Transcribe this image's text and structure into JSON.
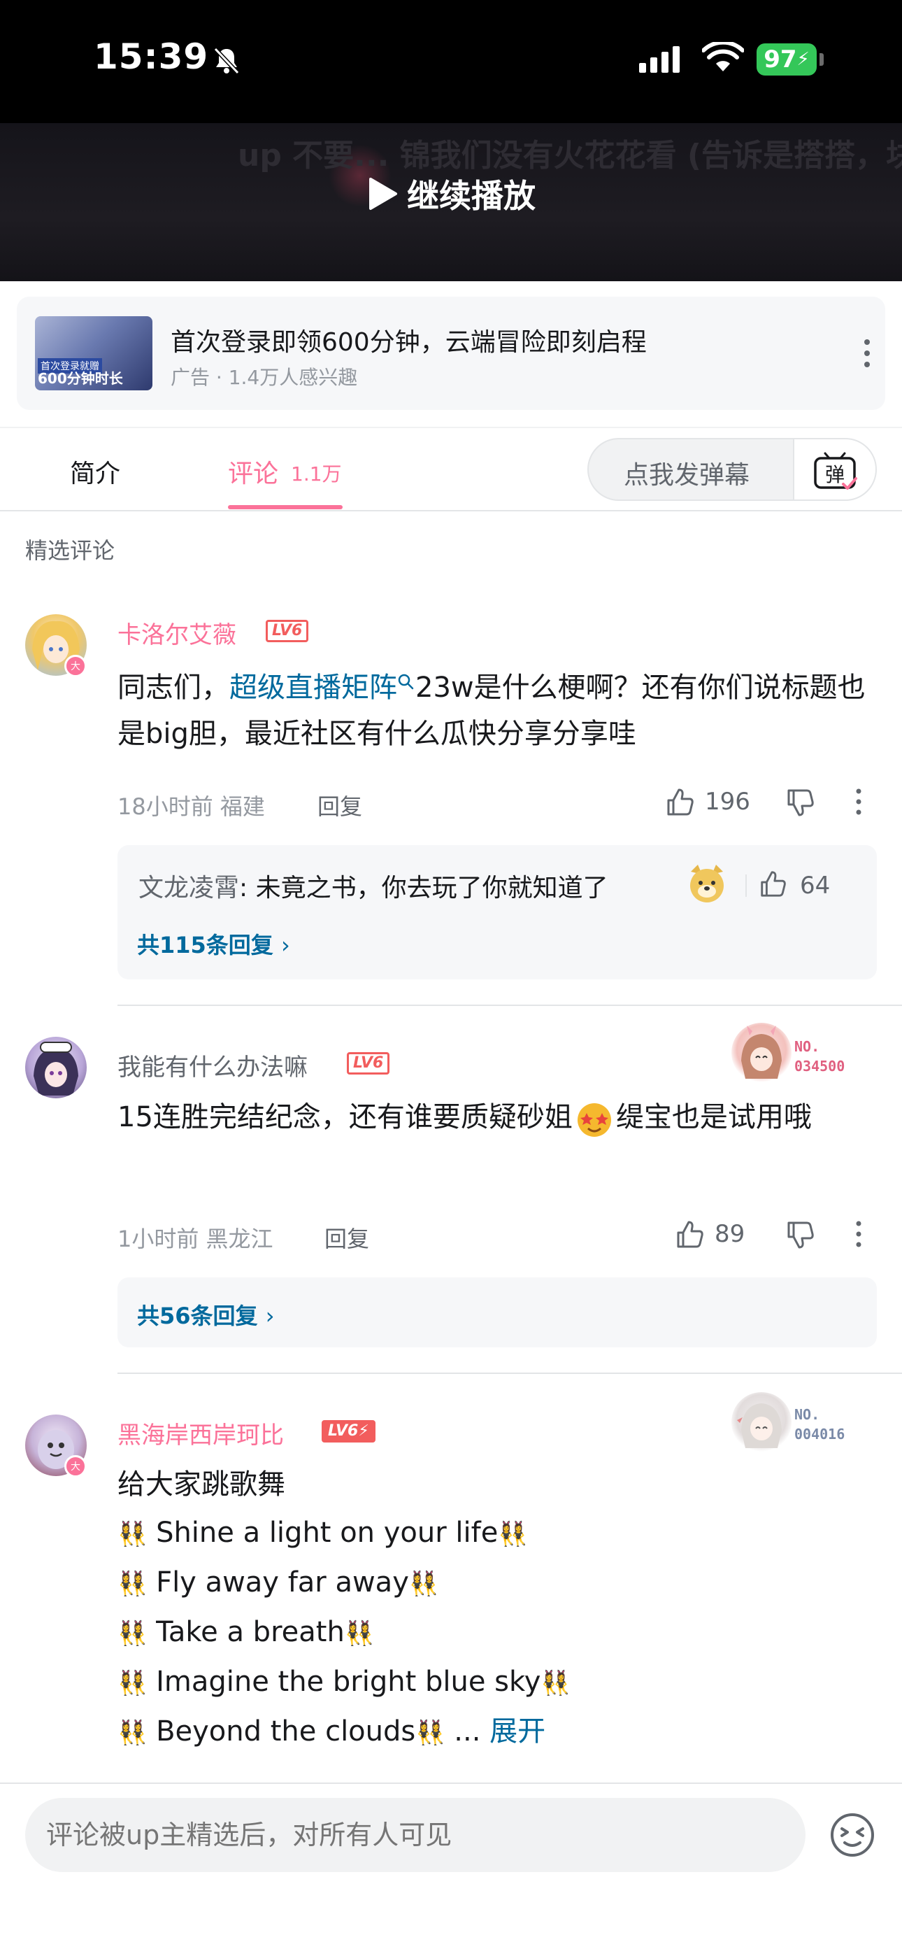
{
  "status_bar": {
    "time": "15:39",
    "battery": "97"
  },
  "video": {
    "resume_label": "继续播放",
    "ghost_text": "up 不要... 锦我们没有火花花看 (告诉是搭搭，块"
  },
  "ad": {
    "title": "首次登录即领600分钟，云端冒险即刻启程",
    "meta": "广告 · 1.4万人感兴趣",
    "thumb_tag": "首次登录就赠",
    "thumb_big": "600分钟时长"
  },
  "tabs": {
    "intro": "简介",
    "comments": "评论",
    "comments_count": "1.1万"
  },
  "danmaku": {
    "label": "点我发弹幕",
    "icon_char": "弹"
  },
  "section_title": "精选评论",
  "comments": [
    {
      "username": "卡洛尔艾薇",
      "level": "LV6",
      "text_prefix": "同志们，",
      "text_link": "超级直播矩阵",
      "text_suffix": "23w是什么梗啊？还有你们说标题也是big胆，最近社区有什么瓜快分享分享哇",
      "time_location": "18小时前 福建",
      "reply_label": "回复",
      "likes": "196",
      "sub_reply_author": "文龙凌霄",
      "sub_reply_text": ": 未竟之书，你去玩了你就知道了",
      "sub_reply_likes": "64",
      "more_replies": "共115条回复"
    },
    {
      "username": "我能有什么办法嘛",
      "level": "LV6",
      "badge_no": "NO.",
      "badge_num": "034500",
      "text": "15连胜完结纪念，还有谁要质疑砂姐",
      "text_tail": "缇宝也是试用哦",
      "time_location": "1小时前 黑龙江",
      "reply_label": "回复",
      "likes": "89",
      "more_replies": "共56条回复"
    },
    {
      "username": "黑海岸西岸珂比",
      "level": "LV6",
      "badge_no": "NO.",
      "badge_num": "004016",
      "lines": [
        "给大家跳歌舞",
        "Shine a light on your life",
        "Fly away far away",
        "Take a breath",
        "Imagine the bright blue sky",
        "Beyond the clouds"
      ],
      "ellipsis": "...",
      "expand": "展开"
    }
  ],
  "input": {
    "placeholder": "评论被up主精选后，对所有人可见"
  },
  "colors": {
    "pink": "#fb7299",
    "link": "#00699d",
    "level_red": "#f25d5d"
  }
}
